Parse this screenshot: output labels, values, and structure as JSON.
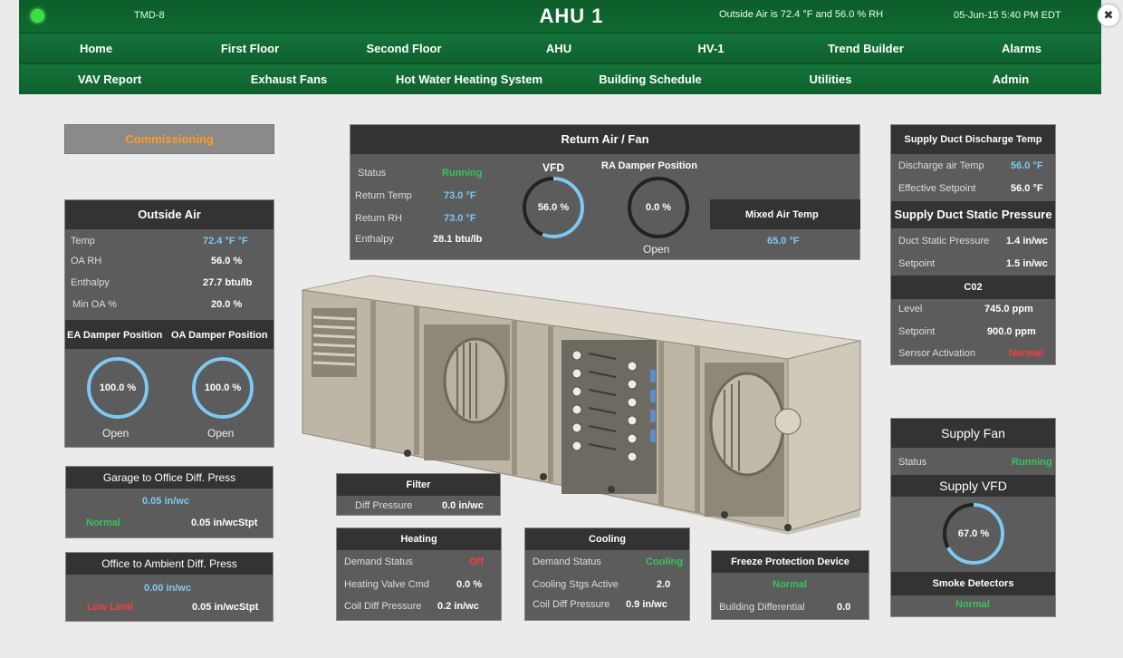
{
  "header": {
    "site_id": "TMD-8",
    "title": "AHU 1",
    "outside_info": "Outside Air is 72.4 °F  and  56.0 % RH",
    "datetime": "05-Jun-15 5:40 PM EDT"
  },
  "nav": {
    "row1": [
      "Home",
      "First Floor",
      "Second Floor",
      "AHU",
      "HV-1",
      "Trend Builder",
      "Alarms"
    ],
    "row2": [
      "VAV Report",
      "Exhaust Fans",
      "Hot Water Heating System",
      "Building Schedule",
      "Utilities",
      "Admin"
    ]
  },
  "commissioning": {
    "label": "Commissioning"
  },
  "outside_air": {
    "title": "Outside Air",
    "temp_label": "Temp",
    "temp_value": "72.4  °F  °F",
    "rh_label": "OA RH",
    "rh_value": "56.0  %",
    "enthalpy_label": "Enthalpy",
    "enthalpy_value": "27.7  btu/lb",
    "min_oa_label": "Min OA %",
    "min_oa_value": "20.0  %",
    "ea_damper_title": "EA Damper Position",
    "oa_damper_title": "OA Damper Position",
    "ea_damper_value": "100.0  %",
    "ea_damper_percent": 100,
    "ea_damper_state": "Open",
    "oa_damper_value": "100.0  %",
    "oa_damper_percent": 100,
    "oa_damper_state": "Open"
  },
  "garage_press": {
    "title": "Garage to Office Diff. Press",
    "value": "0.05  in/wc",
    "status": "Normal",
    "setpoint": "0.05  in/wcStpt"
  },
  "office_press": {
    "title": "Office to Ambient Diff. Press",
    "value": "0.00  in/wc",
    "status": "Low  Limit",
    "setpoint": "0.05  in/wcStpt"
  },
  "return_air": {
    "title": "Return Air / Fan",
    "status_label": "Status",
    "status_value": "Running",
    "temp_label": "Return Temp",
    "temp_value": "73.0  °F",
    "rh_label": "Return RH",
    "rh_value": "73.0  °F",
    "enthalpy_label": "Enthalpy",
    "enthalpy_value": "28.1  btu/lb",
    "vfd_title": "VFD",
    "vfd_value": "56.0  %",
    "vfd_percent": 56,
    "ra_damper_title": "RA  Damper  Position",
    "ra_damper_value": "0.0  %",
    "ra_damper_percent": 0,
    "ra_damper_state": "Open",
    "mixed_air_title": "Mixed Air Temp",
    "mixed_air_value": "65.0  °F"
  },
  "filter": {
    "title": "Filter",
    "diff_label": "Diff Pressure",
    "diff_value": "0.0  in/wc"
  },
  "heating": {
    "title": "Heating",
    "demand_label": "Demand Status",
    "demand_value": "Off",
    "valve_label": "Heating Valve Cmd",
    "valve_value": "0.0  %",
    "coil_label": "Coil Diff Pressure",
    "coil_value": "0.2  in/wc"
  },
  "cooling": {
    "title": "Cooling",
    "demand_label": "Demand Status",
    "demand_value": "Cooling",
    "stages_label": "Cooling Stgs Active",
    "stages_value": "2.0",
    "coil_label": "Coil Diff Pressure",
    "coil_value": "0.9  in/wc"
  },
  "freeze": {
    "title": "Freeze Protection Device",
    "status": "Normal",
    "bldg_label": "Building Differential",
    "bldg_value": "0.0"
  },
  "supply_discharge": {
    "title": "Supply Duct Discharge Temp",
    "discharge_label": "Discharge air Temp",
    "discharge_value": "56.0  °F",
    "setpoint_label": "Effective Setpoint",
    "setpoint_value": "56.0  °F"
  },
  "static_pressure": {
    "title": "Supply Duct Static Pressure",
    "duct_label": "Duct Static Pressure",
    "duct_value": "1.4  in/wc",
    "setpoint_label": "Setpoint",
    "setpoint_value": "1.5  in/wc"
  },
  "co2": {
    "title": "C02",
    "level_label": "Level",
    "level_value": "745.0  ppm",
    "setpoint_label": "Setpoint",
    "setpoint_value": "900.0  ppm",
    "sensor_label": "Sensor Activation",
    "sensor_value": "Normal"
  },
  "supply_fan": {
    "title": "Supply Fan",
    "status_label": "Status",
    "status_value": "Running",
    "vfd_title": "Supply  VFD",
    "vfd_value": "67.0  %",
    "vfd_percent": 67,
    "smoke_title": "Smoke Detectors",
    "smoke_value": "Normal"
  },
  "colors": {
    "nav_green": "#106830",
    "panel_gray": "#5c5c5c",
    "header_dark": "#333333",
    "value_blue": "#7ec8f2",
    "ok_green": "#35c55a",
    "alarm_red": "#ff3a3a",
    "commission_orange": "#ff9a22",
    "gauge_ring": "#7ec8f2"
  },
  "icons": {
    "status_led": "green-status-led",
    "close": "close-expand-icon"
  }
}
